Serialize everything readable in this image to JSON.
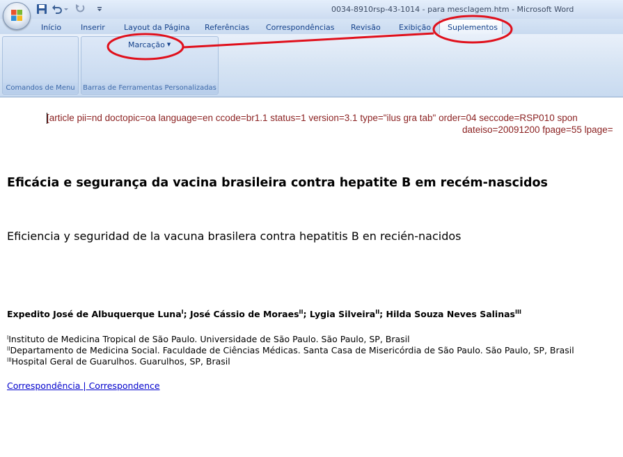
{
  "window": {
    "title": "0034-8910rsp-43-1014 - para mesclagem.htm - Microsoft Word"
  },
  "quick_access": {
    "icons": [
      "save-icon",
      "undo-icon",
      "redo-icon",
      "customize-icon"
    ]
  },
  "ribbon": {
    "tabs": [
      "Início",
      "Inserir",
      "Layout da Página",
      "Referências",
      "Correspondências",
      "Revisão",
      "Exibição",
      "Suplementos"
    ],
    "active_tab": "Suplementos",
    "groups": [
      {
        "label": "Comandos de Menu"
      },
      {
        "label": "Barras de Ferramentas Personalizadas"
      }
    ],
    "marcacao_label": "Marcação"
  },
  "document": {
    "tag_line1": "[article pii=nd doctopic=oa language=en ccode=br1.1 status=1 version=3.1 type=\"ilus gra tab\" order=04 seccode=RSP010 spon",
    "tag_line2": "dateiso=20091200 fpage=55 lpage=",
    "title": "Eficácia e segurança da vacina brasileira contra hepatite B em recém-nascidos",
    "subtitle": "Eficiencia y seguridad de la vacuna brasilera contra hepatitis B en recién-nacidos",
    "authors": [
      {
        "name": "Expedito José de Albuquerque Luna",
        "sup": "I"
      },
      {
        "name": "José Cássio de Moraes",
        "sup": "II"
      },
      {
        "name": "Lygia Silveira",
        "sup": "II"
      },
      {
        "name": "Hilda Souza Neves Salinas",
        "sup": "III"
      }
    ],
    "affiliations": [
      {
        "sup": "I",
        "text": "Instituto de Medicina Tropical de São Paulo. Universidade de São Paulo. São Paulo, SP, Brasil"
      },
      {
        "sup": "II",
        "text": "Departamento de Medicina Social. Faculdade de Ciências Médicas. Santa Casa de Misericórdia de São Paulo. São Paulo, SP, Brasil"
      },
      {
        "sup": "III",
        "text": "Hospital Geral de Guarulhos. Guarulhos, SP, Brasil"
      }
    ],
    "correspondence_link": "Correspondência | Correspondence"
  },
  "colors": {
    "annotation": "#e0101c",
    "tag_text": "#8a1f1f",
    "link": "#0000cc",
    "ribbon_text": "#15428b"
  }
}
